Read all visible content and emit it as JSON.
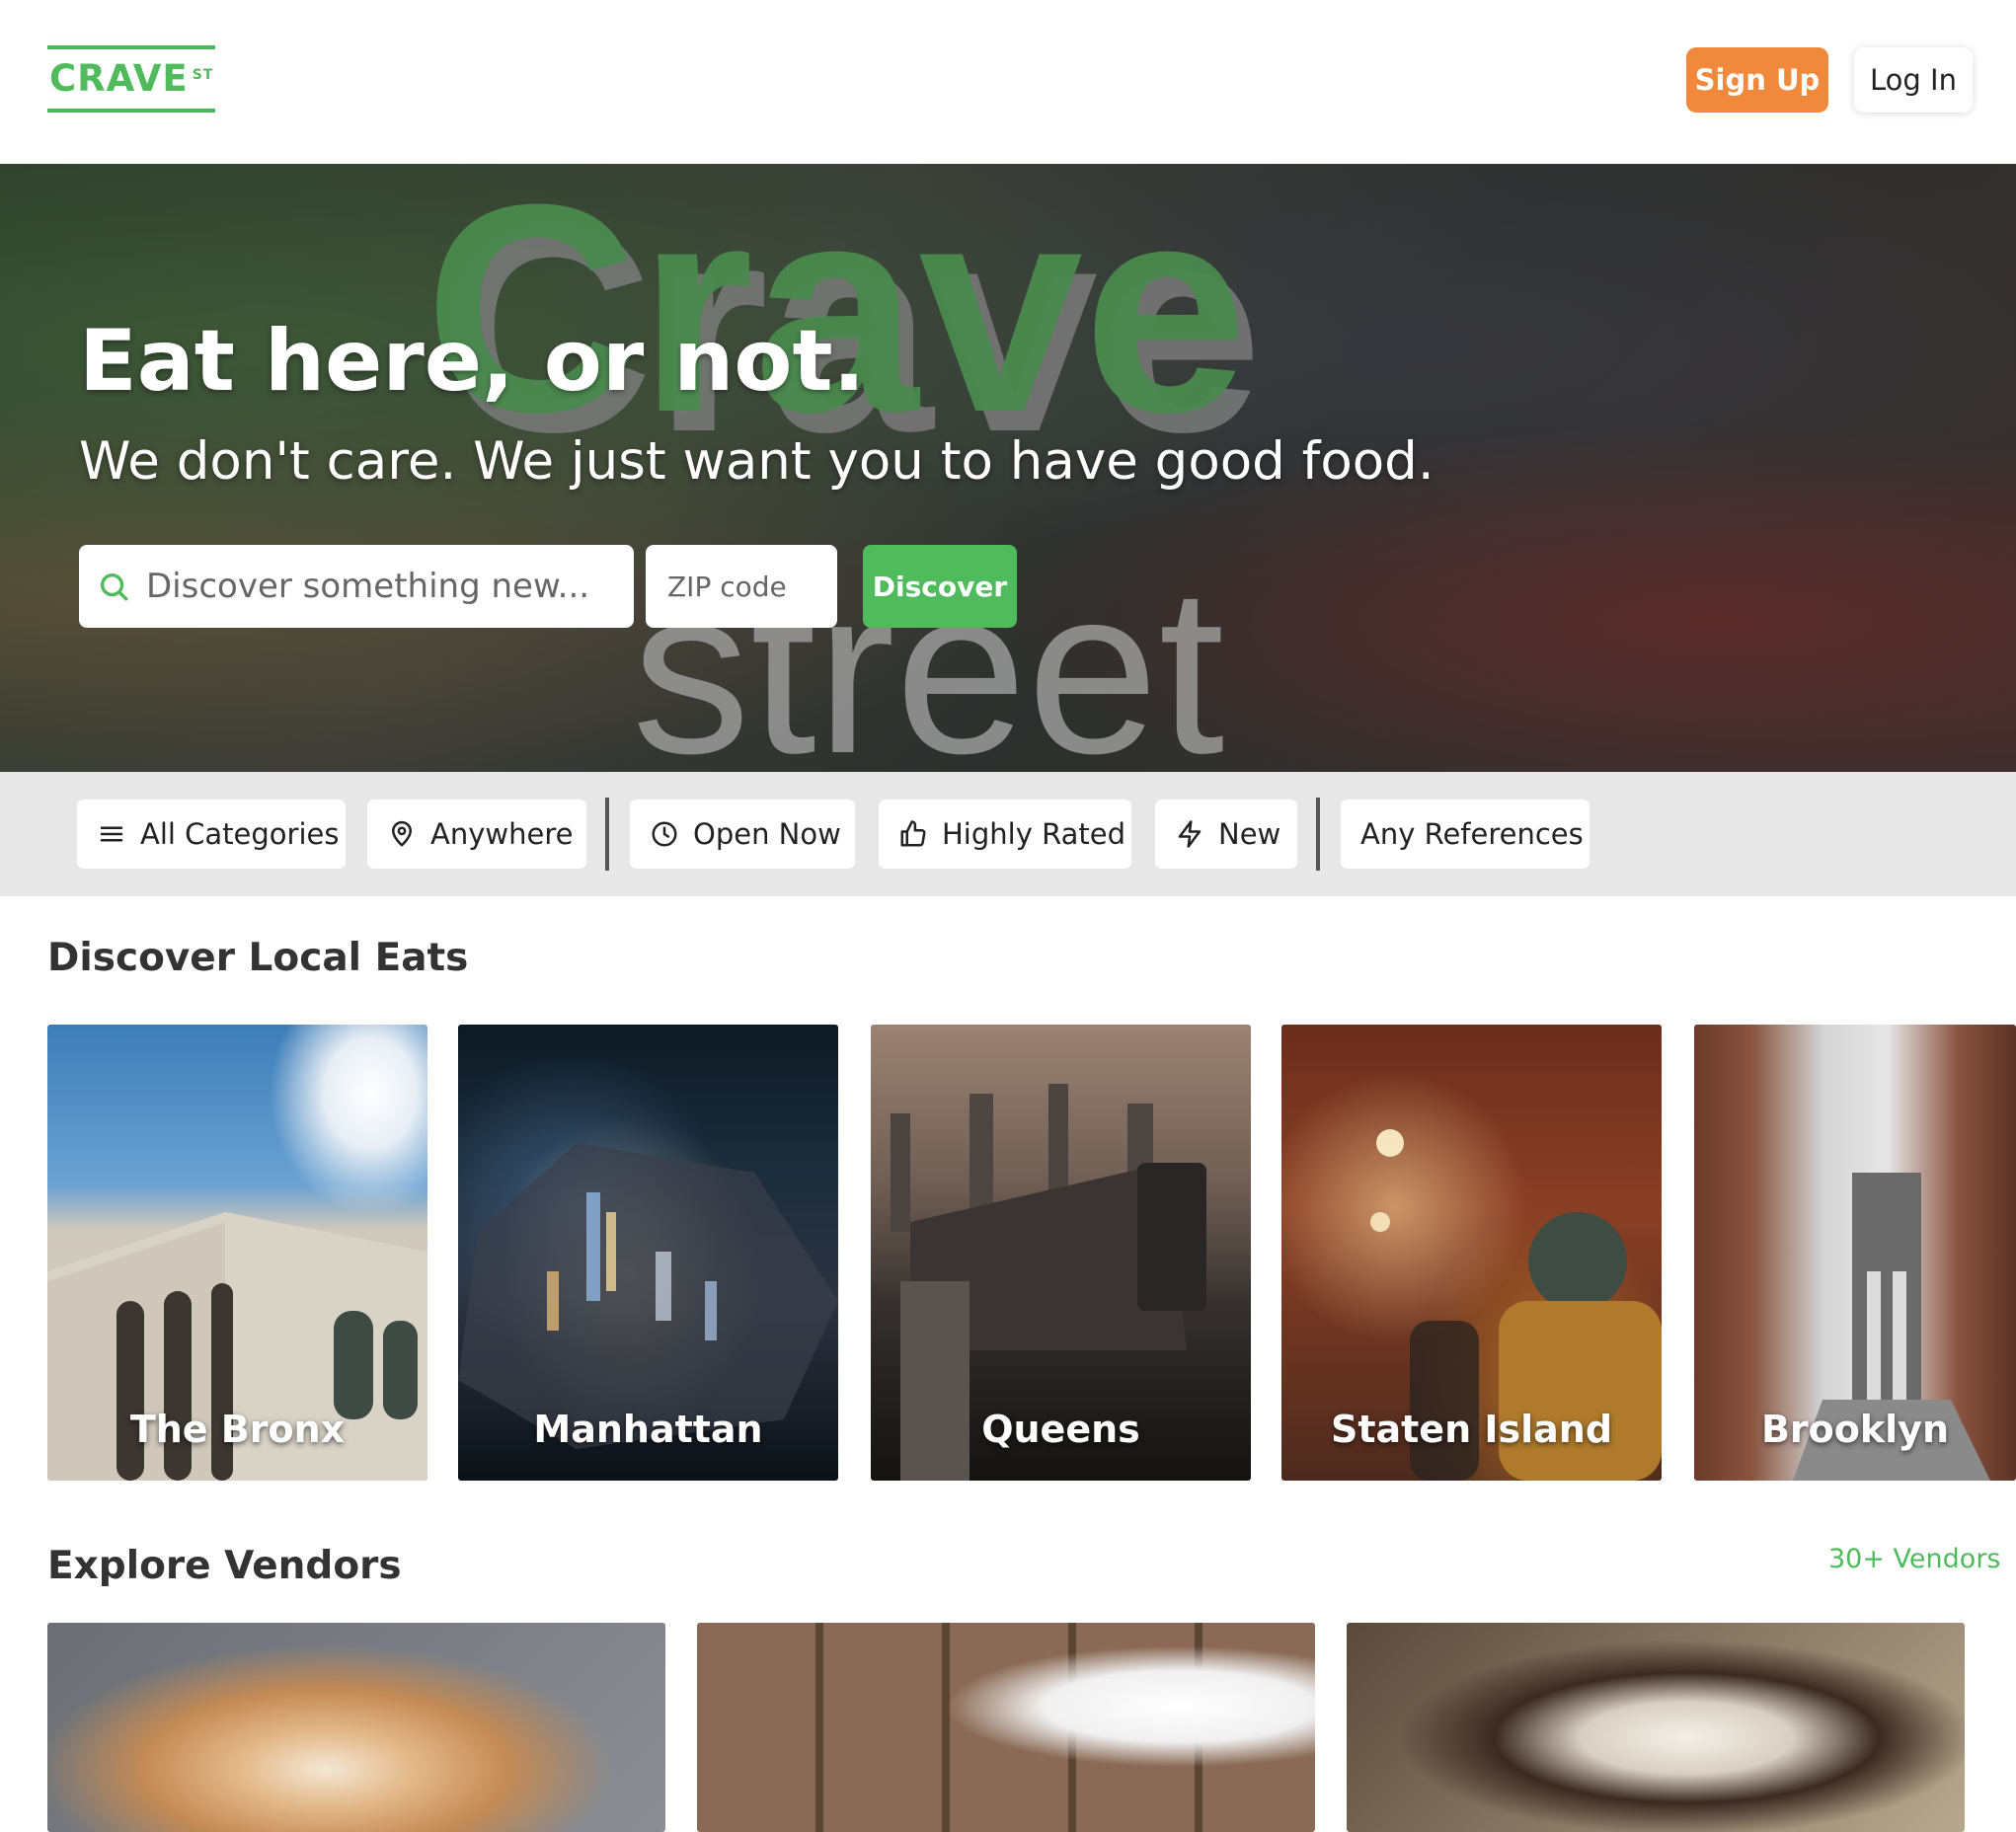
{
  "header": {
    "logo_text": "CRAVE",
    "logo_sup": "ST",
    "signup_label": "Sign Up",
    "login_label": "Log In",
    "brand_color": "#4fbb5c",
    "accent_color": "#f0893b"
  },
  "hero": {
    "watermark_top": "Crave",
    "watermark_bottom": "street",
    "title": "Eat here, or not.",
    "subtitle": "We don't care. We just want you to have good food.",
    "search_placeholder": "Discover something new...",
    "zip_placeholder": "ZIP code",
    "discover_label": "Discover"
  },
  "filters": {
    "items": [
      {
        "label": "All Categories",
        "icon": "menu-icon"
      },
      {
        "label": "Anywhere",
        "icon": "location-pin-icon"
      },
      {
        "label": "Open Now",
        "icon": "clock-icon"
      },
      {
        "label": "Highly Rated",
        "icon": "thumbs-up-icon"
      },
      {
        "label": "New",
        "icon": "lightning-icon"
      },
      {
        "label": "Any References",
        "icon": ""
      }
    ]
  },
  "local_eats": {
    "title": "Discover Local Eats",
    "boroughs": [
      "The Bronx",
      "Manhattan",
      "Queens",
      "Staten Island",
      "Brooklyn"
    ]
  },
  "vendors": {
    "title": "Explore Vendors",
    "count_link": "30+ Vendors"
  }
}
